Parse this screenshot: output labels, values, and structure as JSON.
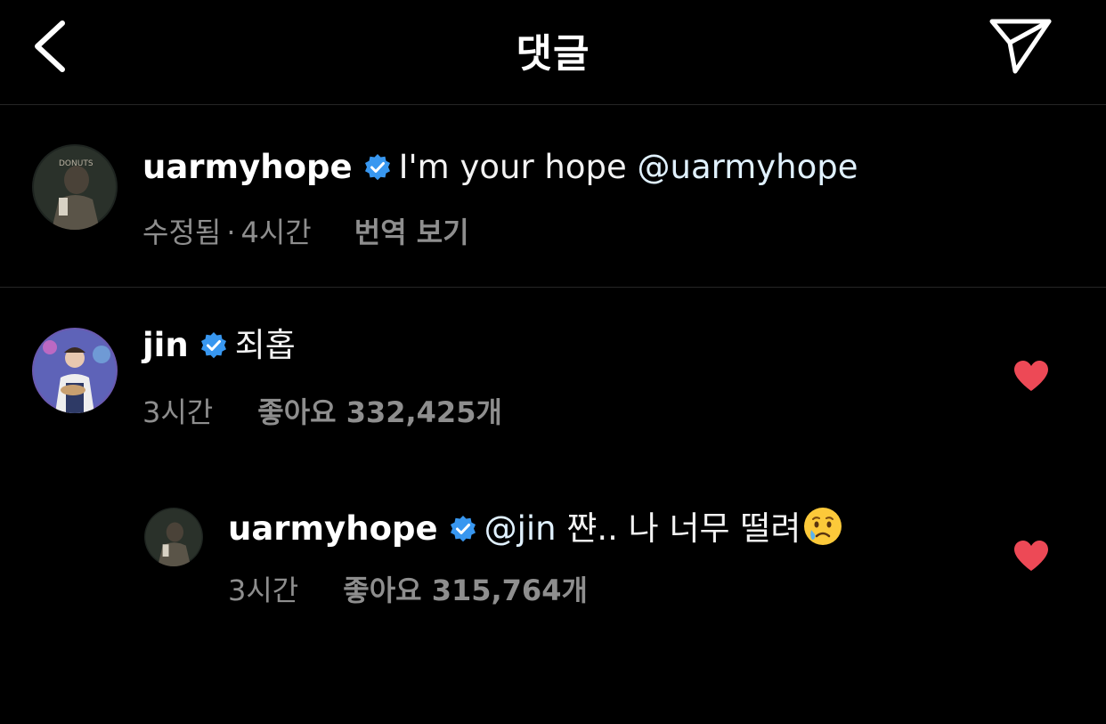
{
  "header": {
    "title": "댓글"
  },
  "caption": {
    "username": "uarmyhope",
    "text": "I'm your hope ",
    "mention": "@uarmyhope",
    "edited": "수정됨",
    "separator": "·",
    "time": "4시간",
    "translate": "번역 보기"
  },
  "comments": [
    {
      "username": "jin",
      "text": "죄홉",
      "time": "3시간",
      "likes_label": "좋아요 332,425개",
      "liked": true
    }
  ],
  "reply": {
    "username": "uarmyhope",
    "mention": "@jin",
    "text": " 쨘.. 나 너무 떨려",
    "time": "3시간",
    "likes_label": "좋아요 315,764개",
    "liked": true
  },
  "colors": {
    "background": "#000000",
    "verified": "#3897f0",
    "heart": "#ed4956",
    "meta": "#8e8e8e",
    "divider": "#262626"
  },
  "icons": {
    "back": "chevron-left-icon",
    "share": "paper-plane-icon",
    "verified": "verified-badge-icon",
    "like": "heart-icon",
    "emoji": "crying-face-emoji"
  }
}
